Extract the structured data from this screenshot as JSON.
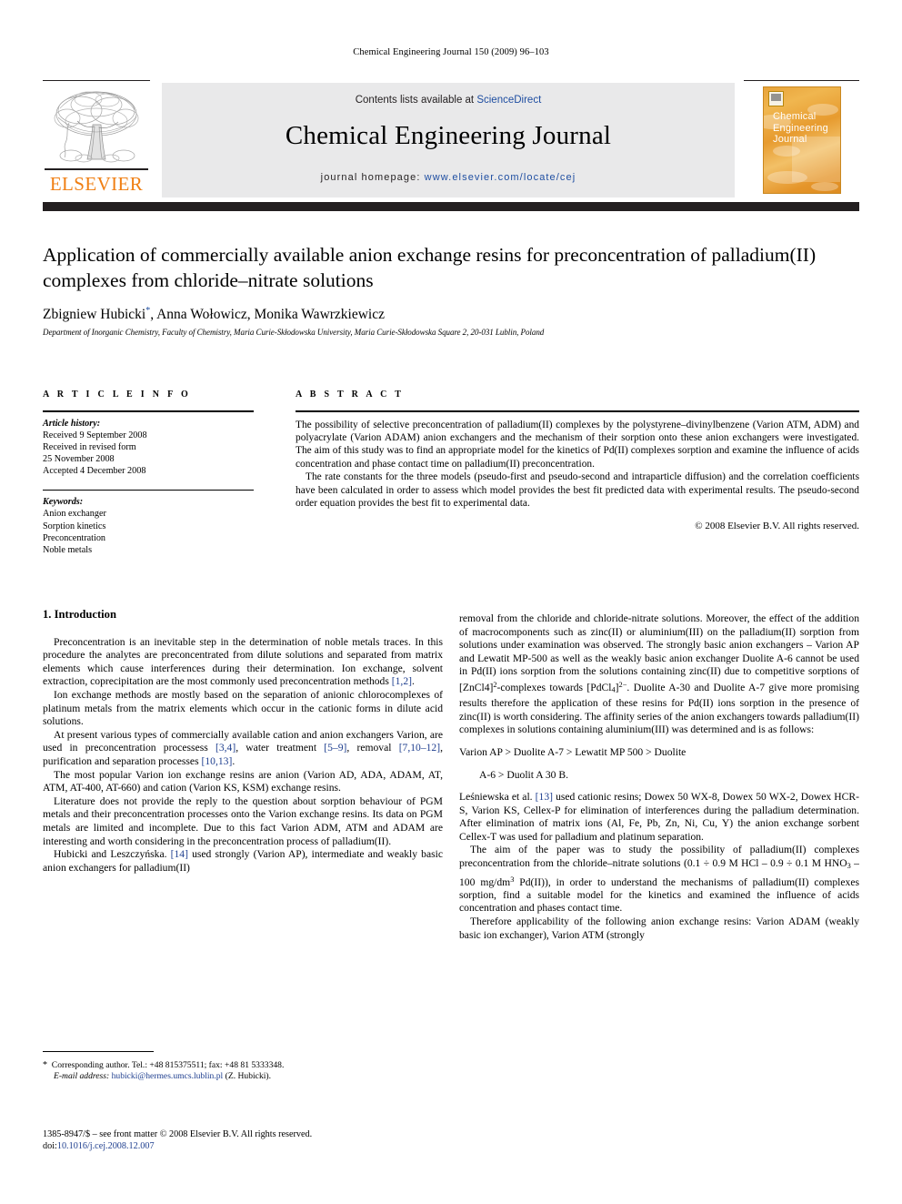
{
  "running_head": "Chemical Engineering Journal 150 (2009) 96–103",
  "masthead": {
    "publisher_name": "ELSEVIER",
    "contents_prefix": "Contents lists available at ",
    "contents_link": "ScienceDirect",
    "journal_title": "Chemical Engineering Journal",
    "homepage_prefix": "journal homepage: ",
    "homepage_url": "www.elsevier.com/locate/cej",
    "cover_title_line1": "Chemical",
    "cover_title_line2": "Engineering",
    "cover_title_line3": "Journal",
    "colors": {
      "elsevier_orange": "#f07f13",
      "band_grey": "#e9e9ea",
      "bar_dark": "#231f20",
      "link_blue": "#1f4ea1",
      "cover_amber": "#e79b2f"
    }
  },
  "article": {
    "title": "Application of commercially available anion exchange resins for preconcentration of palladium(II) complexes from chloride–nitrate solutions",
    "authors_part1": "Zbigniew Hubicki",
    "authors_marker": "*",
    "authors_part2": ", Anna Wołowicz, Monika Wawrzkiewicz",
    "affiliation": "Department of Inorganic Chemistry, Faculty of Chemistry, Maria Curie-Skłodowska University, Maria Curie-Skłodowska Square 2, 20-031 Lublin, Poland"
  },
  "article_info": {
    "heading": "A R T I C L E   I N F O",
    "history_label": "Article history:",
    "history_lines": [
      "Received 9 September 2008",
      "Received in revised form",
      "25 November 2008",
      "Accepted 4 December 2008"
    ],
    "keywords_label": "Keywords:",
    "keywords": [
      "Anion exchanger",
      "Sorption kinetics",
      "Preconcentration",
      "Noble metals"
    ]
  },
  "abstract": {
    "heading": "A B S T R A C T",
    "paragraph1": "The possibility of selective preconcentration of palladium(II) complexes by the polystyrene–divinylbenzene (Varion ATM, ADM) and polyacrylate (Varion ADAM) anion exchangers and the mechanism of their sorption onto these anion exchangers were investigated. The aim of this study was to find an appropriate model for the kinetics of Pd(II) complexes sorption and examine the influence of acids concentration and phase contact time on palladium(II) preconcentration.",
    "paragraph2": "The rate constants for the three models (pseudo-first and pseudo-second and intraparticle diffusion) and the correlation coefficients have been calculated in order to assess which model provides the best fit predicted data with experimental results. The pseudo-second order equation provides the best fit to experimental data.",
    "copyright": "© 2008 Elsevier B.V. All rights reserved."
  },
  "body": {
    "section_number_title": "1.  Introduction",
    "left_paragraphs": [
      "Preconcentration is an inevitable step in the determination of noble metals traces. In this procedure the analytes are preconcentrated from dilute solutions and separated from matrix elements which cause interferences during their determination. Ion exchange, solvent extraction, coprecipitation are the most commonly used preconcentration methods [1,2].",
      "Ion exchange methods are mostly based on the separation of anionic chlorocomplexes of platinum metals from the matrix elements which occur in the cationic forms in dilute acid solutions.",
      "At present various types of commercially available cation and anion exchangers Varion, are used in preconcentration processess [3,4], water treatment [5–9], removal [7,10–12], purification and separation processes [10,13].",
      "The most popular Varion ion exchange resins are anion (Varion AD, ADA, ADAM, AT, ATM, AT-400, AT-660) and cation (Varion KS, KSM) exchange resins.",
      "Literature does not provide the reply to the question about sorption behaviour of PGM metals and their preconcentration processes onto the Varion exchange resins. Its data on PGM metals are limited and incomplete. Due to this fact Varion ADM, ATM and ADAM are interesting and worth considering in the preconcentration process of palladium(II).",
      "Hubicki and Leszczyńska. [14] used strongly (Varion AP), intermediate and weakly basic anion exchangers for palladium(II)"
    ],
    "right_paragraph_continued": "removal from the chloride and chloride-nitrate solutions. Moreover, the effect of the addition of macrocomponents such as zinc(II) or aluminium(III) on the palladium(II) sorption from solutions under examination was observed. The strongly basic anion exchangers – Varion AP and Lewatit MP-500 as well as the weakly basic anion exchanger Duolite A-6 cannot be used in Pd(II) ions sorption from the solutions containing zinc(II) due to competitive sorptions of [ZnCl4]2-complexes towards [PdCl4]2−. Duolite A-30 and Duolite A-7 give more promising results therefore the application of these resins for Pd(II) ions sorption in the presence of zinc(II) is worth considering. The affinity series of the anion exchangers towards palladium(II) complexes in solutions containing aluminium(III) was determined and is as follows:",
    "affinity_line1": "Varion AP > Duolite A-7 > Lewatit MP 500 > Duolite",
    "affinity_line2": "A-6 > Duolit A 30 B.",
    "right_paragraphs": [
      "Leśniewska et al. [13] used cationic resins; Dowex 50 WX-8, Dowex 50 WX-2, Dowex HCR-S, Varion KS, Cellex-P for elimination of interferences during the palladium determination. After elimination of matrix ions (Al, Fe, Pb, Zn, Ni, Cu, Y) the anion exchange sorbent Cellex-T was used for palladium and platinum separation.",
      "The aim of the paper was to study the possibility of palladium(II) complexes preconcentration from the chloride–nitrate solutions (0.1 ÷ 0.9 M HCl – 0.9 ÷ 0.1 M HNO3 – 100 mg/dm3 Pd(II)), in order to understand the mechanisms of palladium(II) complexes sorption, find a suitable model for the kinetics and examined the influence of acids concentration and phases contact time.",
      "Therefore applicability of the following anion exchange resins: Varion ADAM (weakly basic ion exchanger), Varion ATM (strongly"
    ]
  },
  "footnotes": {
    "corresponding_marker": "*",
    "corresponding_text": "Corresponding author. Tel.: +48 815375511; fax: +48 81 5333348.",
    "email_label": "E-mail address:",
    "email_address": "hubicki@hermes.umcs.lublin.pl",
    "email_owner": "(Z. Hubicki).",
    "issn_line": "1385-8947/$ – see front matter © 2008 Elsevier B.V. All rights reserved.",
    "doi_label": "doi:",
    "doi_value": "10.1016/j.cej.2008.12.007"
  }
}
